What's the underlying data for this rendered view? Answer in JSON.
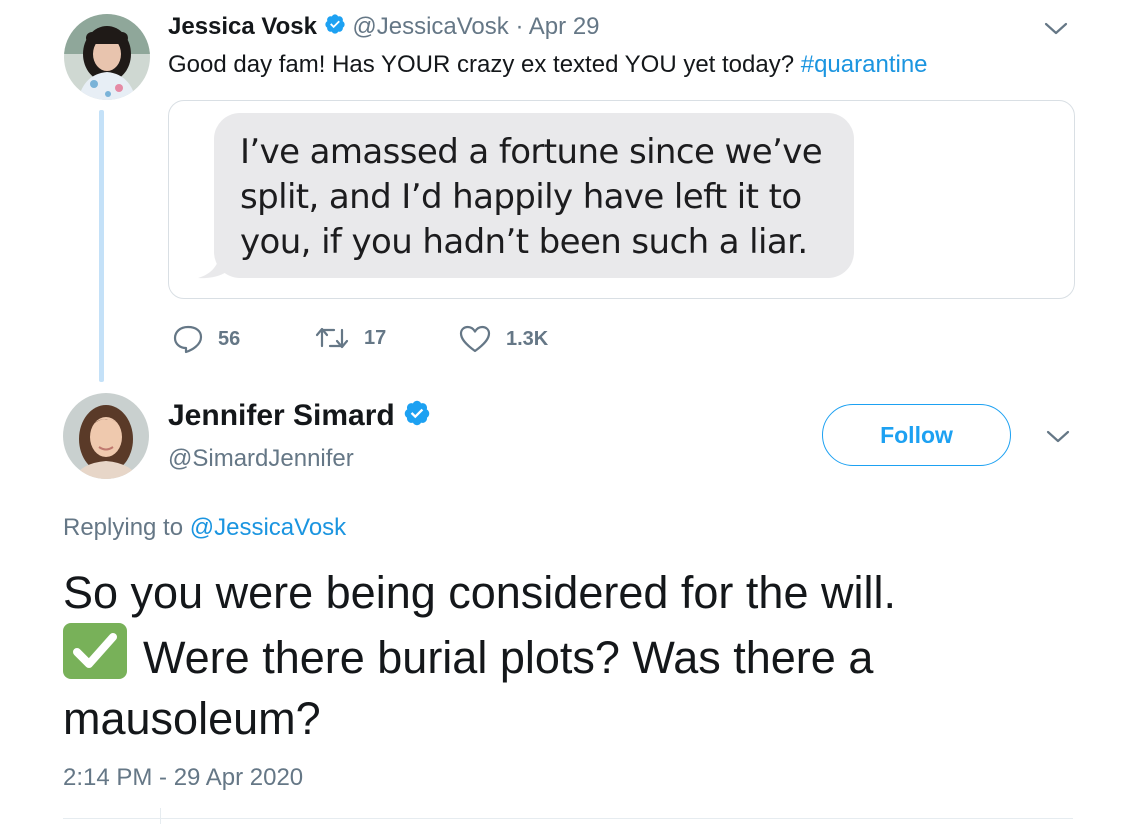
{
  "parent_tweet": {
    "author_name": "Jessica Vosk",
    "author_handle": "@JessicaVosk",
    "separator": "·",
    "date": "Apr 29",
    "text_prefix": "Good day fam! Has YOUR crazy ex texted YOU yet today? ",
    "hashtag": "#quarantine",
    "image_text_lines": [
      "I’ve amassed a fortune since we’ve",
      "split, and I’d happily have left it to",
      "you, if you hadn’t been such a liar."
    ],
    "stats": {
      "replies": "56",
      "retweets": "17",
      "likes": "1.3K"
    }
  },
  "reply_tweet": {
    "author_name": "Jennifer Simard",
    "author_handle": "@SimardJennifer",
    "follow_label": "Follow",
    "replying_prefix": "Replying to ",
    "replying_handle": "@JessicaVosk",
    "text_line1": "So you were being considered for the will.",
    "text_line2": "Were there burial plots? Was there a",
    "text_line3": "mausoleum?",
    "timestamp": "2:14 PM - 29 Apr 2020"
  },
  "icons": {
    "verified": "verified-badge-icon",
    "chevron": "chevron-down-icon",
    "reply": "reply-icon",
    "retweet": "retweet-icon",
    "like": "heart-icon",
    "check": "check-mark-button-emoji"
  },
  "colors": {
    "accent": "#1da1f2",
    "link": "#1b95e0",
    "muted": "#657786",
    "thread_line": "#c4e1f8",
    "bubble": "#e9e9eb",
    "emoji_green": "#78b159"
  }
}
